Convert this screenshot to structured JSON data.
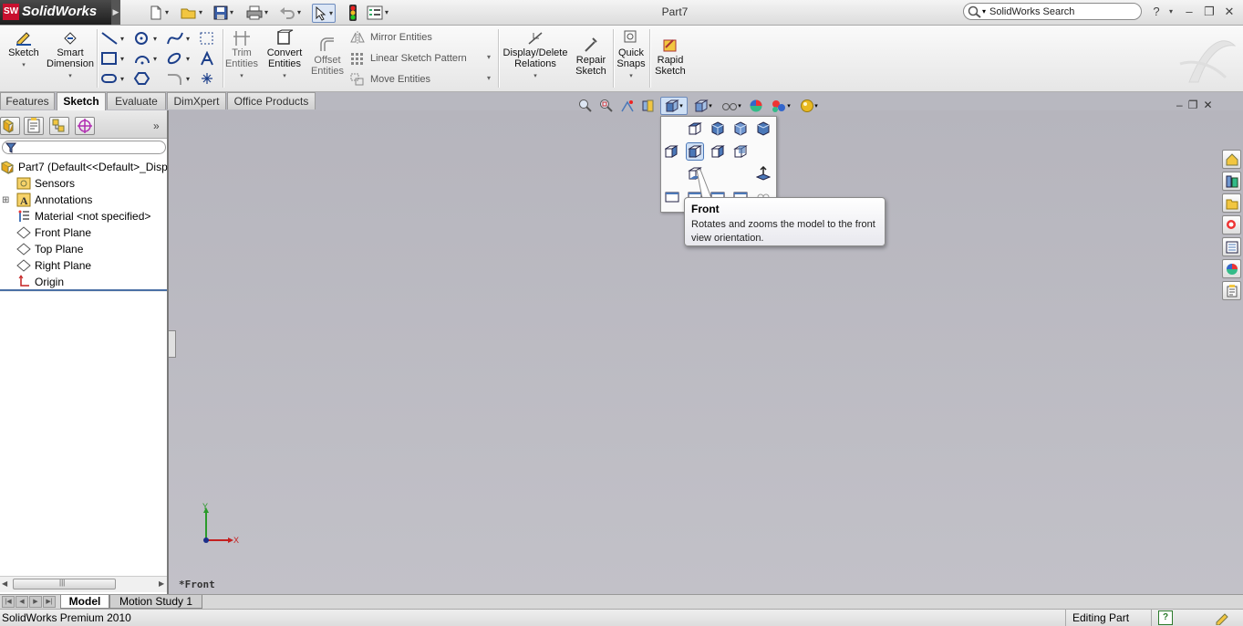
{
  "app": {
    "logo_text": "SolidWorks",
    "doc_title": "Part7",
    "search_value": "SolidWorks Search"
  },
  "commands": {
    "sketch": "Sketch",
    "smart_dimension": "Smart Dimension",
    "trim_entities": "Trim Entities",
    "convert_entities": "Convert Entities",
    "offset_entities": "Offset Entities",
    "mirror_entities": "Mirror Entities",
    "linear_sketch_pattern": "Linear Sketch Pattern",
    "move_entities": "Move Entities",
    "display_delete_relations": "Display/Delete Relations",
    "repair_sketch": "Repair Sketch",
    "quick_snaps": "Quick Snaps",
    "rapid_sketch": "Rapid Sketch"
  },
  "tabs": [
    "Features",
    "Sketch",
    "Evaluate",
    "DimXpert",
    "Office Products"
  ],
  "active_tab": "Sketch",
  "tree": {
    "root": "Part7  (Default<<Default>_Disp",
    "items": [
      "Sensors",
      "Annotations",
      "Material <not specified>",
      "Front Plane",
      "Top Plane",
      "Right Plane",
      "Origin"
    ]
  },
  "tooltip": {
    "title": "Front",
    "description": "Rotates and zooms the model to the front view orientation."
  },
  "viewport": {
    "view_label": "*Front",
    "axis_y": "Y",
    "axis_x": "X"
  },
  "bottom_tabs": [
    "Model",
    "Motion Study 1"
  ],
  "status": {
    "product": "SolidWorks Premium 2010",
    "mode": "Editing Part"
  },
  "colors": {
    "viewport_bg": "#b8b8c0",
    "accent_blue": "#4b78b8",
    "brand_red": "#c8102e"
  }
}
